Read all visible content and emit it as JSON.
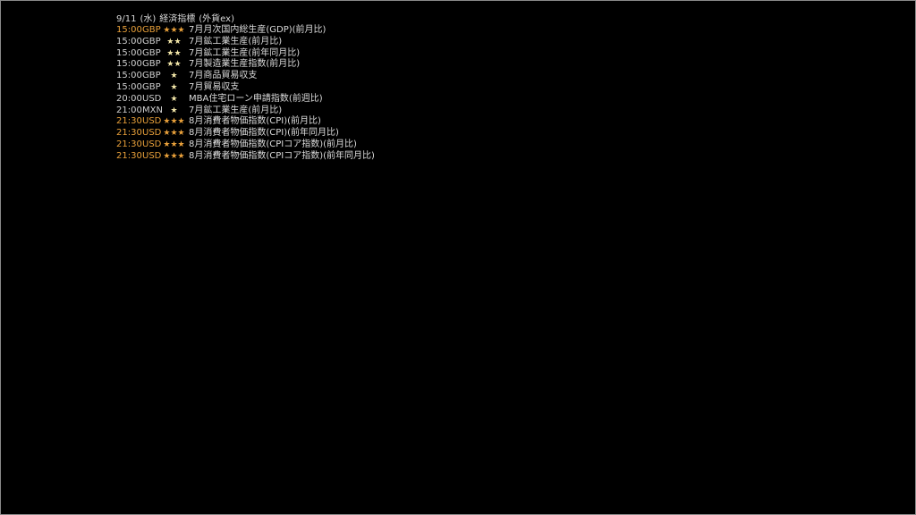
{
  "header": {
    "date": "9/11",
    "weekday": "(水)",
    "title": "経済指標",
    "source": "(外貨ex)"
  },
  "events": [
    {
      "time": "15:00",
      "currency": "GBP",
      "stars": "★★★",
      "name": "7月月次国内総生産(GDP)(前月比)",
      "importance": "high"
    },
    {
      "time": "15:00",
      "currency": "GBP",
      "stars": "★★",
      "name": "7月鉱工業生産(前月比)",
      "importance": "normal"
    },
    {
      "time": "15:00",
      "currency": "GBP",
      "stars": "★★",
      "name": "7月鉱工業生産(前年同月比)",
      "importance": "normal"
    },
    {
      "time": "15:00",
      "currency": "GBP",
      "stars": "★★",
      "name": "7月製造業生産指数(前月比)",
      "importance": "normal"
    },
    {
      "time": "15:00",
      "currency": "GBP",
      "stars": "★",
      "name": "7月商品貿易収支",
      "importance": "normal"
    },
    {
      "time": "15:00",
      "currency": "GBP",
      "stars": "★",
      "name": "7月貿易収支",
      "importance": "normal"
    },
    {
      "time": "20:00",
      "currency": "USD",
      "stars": "★",
      "name": "MBA住宅ローン申請指数(前週比)",
      "importance": "normal"
    },
    {
      "time": "21:00",
      "currency": "MXN",
      "stars": "★",
      "name": "7月鉱工業生産(前月比)",
      "importance": "normal"
    },
    {
      "time": "21:30",
      "currency": "USD",
      "stars": "★★★",
      "name": "8月消費者物価指数(CPI)(前月比)",
      "importance": "high"
    },
    {
      "time": "21:30",
      "currency": "USD",
      "stars": "★★★",
      "name": "8月消費者物価指数(CPI)(前年同月比)",
      "importance": "high"
    },
    {
      "time": "21:30",
      "currency": "USD",
      "stars": "★★★",
      "name": "8月消費者物価指数(CPIコア指数)(前月比)",
      "importance": "high"
    },
    {
      "time": "21:30",
      "currency": "USD",
      "stars": "★★★",
      "name": "8月消費者物価指数(CPIコア指数)(前年同月比)",
      "importance": "high"
    }
  ],
  "colors": {
    "background": "#000000",
    "high_importance": "#e8a03a",
    "normal_text": "#cfcfcf",
    "star_normal": "#f2e6a8"
  }
}
